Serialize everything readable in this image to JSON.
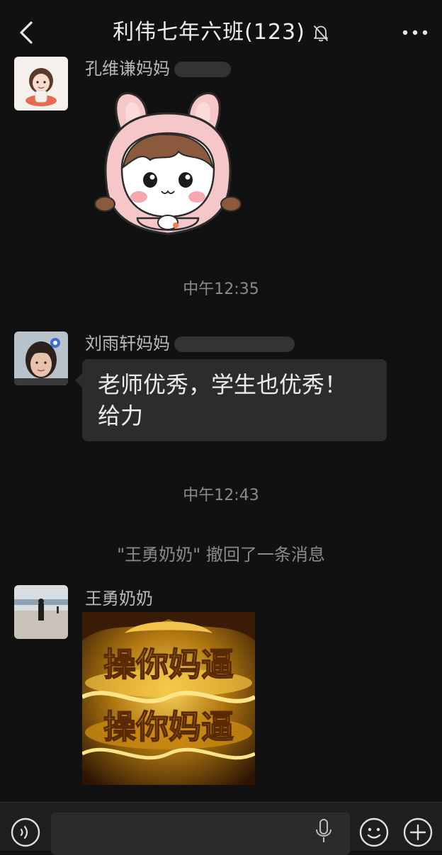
{
  "header": {
    "title": "利伟七年六班(123)",
    "back_icon": "chevron-left-icon",
    "mute_icon": "bell-off-icon",
    "more_icon": "more-dots-icon"
  },
  "messages": [
    {
      "sender": "孔维谦妈妈",
      "type": "sticker",
      "sticker_description_icon": "bunny-girl-sticker"
    },
    {
      "type": "timestamp",
      "text": "中午12:35"
    },
    {
      "sender": "刘雨轩妈妈",
      "type": "text",
      "lines": [
        "老师优秀，学生也优秀！",
        "给力"
      ]
    },
    {
      "type": "timestamp",
      "text": "中午12:43"
    },
    {
      "type": "system",
      "text": "\"王勇奶奶\" 撤回了一条消息"
    },
    {
      "sender": "王勇奶奶",
      "type": "image",
      "image_text_top": "操你妈逼",
      "image_text_bottom": "操你妈逼"
    }
  ],
  "input_bar": {
    "voice_icon": "voice-icon",
    "mic_icon": "microphone-icon",
    "emoji_icon": "emoji-icon",
    "plus_icon": "plus-icon"
  },
  "colors": {
    "background": "#111111",
    "bubble": "#2c2c2c",
    "secondary_text": "#8a8a8a"
  }
}
